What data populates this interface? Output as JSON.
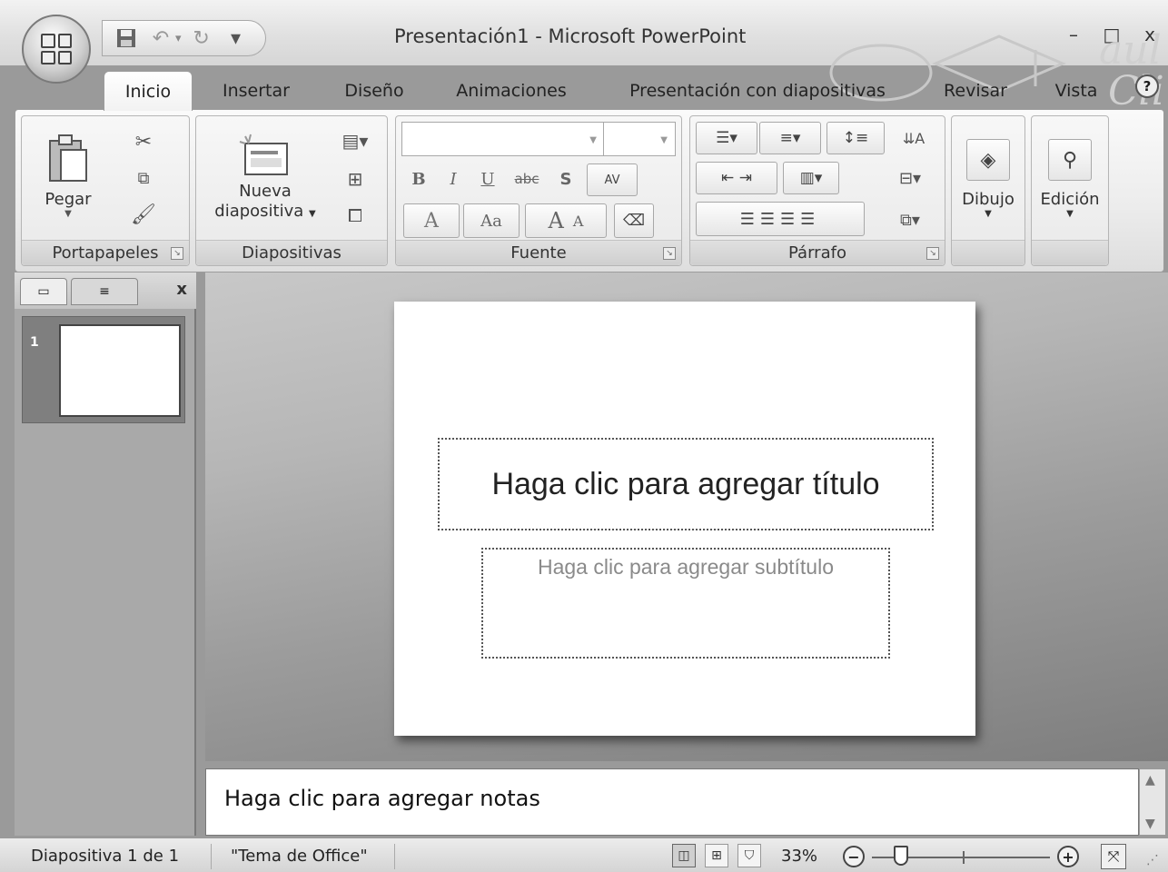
{
  "window": {
    "title": "Presentación1 - Microsoft PowerPoint",
    "controls": {
      "minimize": "–",
      "maximize": "□",
      "close": "x"
    }
  },
  "quick_access": {
    "save_icon": "save-icon",
    "undo_icon": "undo-icon",
    "redo_icon": "redo-icon",
    "customize": "▾"
  },
  "tabs": [
    {
      "label": "Inicio",
      "active": true
    },
    {
      "label": "Insertar"
    },
    {
      "label": "Diseño"
    },
    {
      "label": "Animaciones"
    },
    {
      "label": "Presentación con diapositivas"
    },
    {
      "label": "Revisar"
    },
    {
      "label": "Vista"
    }
  ],
  "help": "?",
  "ribbon": {
    "portapapeles": {
      "label": "Portapapeles",
      "paste": "Pegar"
    },
    "diapositivas": {
      "label": "Diapositivas",
      "new_slide_line1": "Nueva",
      "new_slide_line2": "diapositiva"
    },
    "fuente": {
      "label": "Fuente",
      "bold": "B",
      "italic": "I",
      "underline": "U",
      "strike": "abc",
      "shadow": "S",
      "spacing": "AV",
      "color_a": "A",
      "case": "Aa",
      "grow": "A",
      "shrink": "A"
    },
    "parrafo": {
      "label": "Párrafo"
    },
    "dibujo": {
      "label": "Dibujo"
    },
    "edicion": {
      "label": "Edición"
    }
  },
  "slides_pane": {
    "thumb_number": "1",
    "close": "x"
  },
  "slide": {
    "title_placeholder": "Haga clic para agregar título",
    "subtitle_placeholder": "Haga clic para agregar subtítulo"
  },
  "notes": {
    "placeholder": "Haga clic para agregar notas"
  },
  "status": {
    "slide_info": "Diapositiva 1 de 1",
    "theme": "\"Tema de Office\"",
    "zoom": "33%"
  },
  "colors": {
    "ribbon_bg": "#ececec",
    "canvas_bg": "#a8a8a8",
    "slide_bg": "#ffffff"
  }
}
